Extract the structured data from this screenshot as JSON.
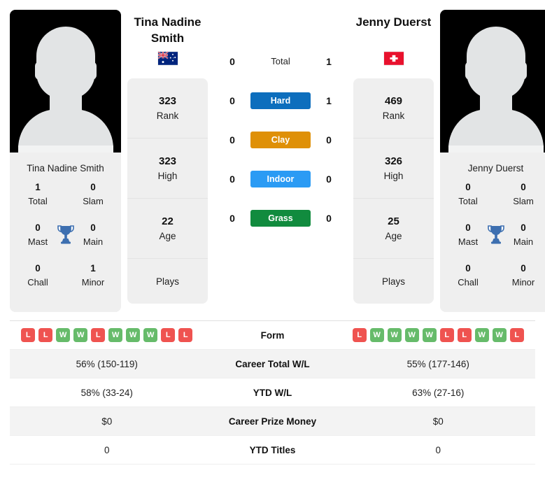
{
  "players": {
    "left": {
      "name": "Tina Nadine Smith",
      "name_line1": "Tina Nadine",
      "name_line2": "Smith",
      "country": "Australia",
      "flag": "au-flag",
      "rank": "323",
      "rank_label": "Rank",
      "high": "323",
      "high_label": "High",
      "age": "22",
      "age_label": "Age",
      "plays": "Plays",
      "plays_value": "",
      "titles": {
        "total": "1",
        "total_label": "Total",
        "slam": "0",
        "slam_label": "Slam",
        "mast": "0",
        "mast_label": "Mast",
        "main": "0",
        "main_label": "Main",
        "chall": "0",
        "chall_label": "Chall",
        "minor": "1",
        "minor_label": "Minor"
      },
      "form": [
        "L",
        "L",
        "W",
        "W",
        "L",
        "W",
        "W",
        "W",
        "L",
        "L"
      ],
      "career_wl": "56% (150-119)",
      "ytd_wl": "58% (33-24)",
      "prize_money": "$0",
      "ytd_titles": "0"
    },
    "right": {
      "name": "Jenny Duerst",
      "name_line1": "Jenny Duerst",
      "name_line2": "",
      "country": "Switzerland",
      "flag": "ch-flag",
      "rank": "469",
      "rank_label": "Rank",
      "high": "326",
      "high_label": "High",
      "age": "25",
      "age_label": "Age",
      "plays": "Plays",
      "plays_value": "",
      "titles": {
        "total": "0",
        "total_label": "Total",
        "slam": "0",
        "slam_label": "Slam",
        "mast": "0",
        "mast_label": "Mast",
        "main": "0",
        "main_label": "Main",
        "chall": "0",
        "chall_label": "Chall",
        "minor": "0",
        "minor_label": "Minor"
      },
      "form": [
        "L",
        "W",
        "W",
        "W",
        "W",
        "L",
        "L",
        "W",
        "W",
        "L"
      ],
      "career_wl": "55% (177-146)",
      "ytd_wl": "63% (27-16)",
      "prize_money": "$0",
      "ytd_titles": "0"
    }
  },
  "head_to_head": {
    "rows": [
      {
        "label": "Total",
        "left": "0",
        "right": "1",
        "pill": false,
        "color": ""
      },
      {
        "label": "Hard",
        "left": "0",
        "right": "1",
        "pill": true,
        "color": "#0d6ebd"
      },
      {
        "label": "Clay",
        "left": "0",
        "right": "0",
        "pill": true,
        "color": "#df9007"
      },
      {
        "label": "Indoor",
        "left": "0",
        "right": "0",
        "pill": true,
        "color": "#2b9bf4"
      },
      {
        "label": "Grass",
        "left": "0",
        "right": "0",
        "pill": true,
        "color": "#118b3e"
      }
    ]
  },
  "stats_table": {
    "rows": [
      {
        "label": "Form",
        "type": "form"
      },
      {
        "label": "Career Total W/L",
        "type": "text",
        "left": "56% (150-119)",
        "right": "55% (177-146)"
      },
      {
        "label": "YTD W/L",
        "type": "text",
        "left": "58% (33-24)",
        "right": "63% (27-16)"
      },
      {
        "label": "Career Prize Money",
        "type": "text",
        "left": "$0",
        "right": "$0"
      },
      {
        "label": "YTD Titles",
        "type": "text",
        "left": "0",
        "right": "0"
      }
    ]
  },
  "colors": {
    "hard": "#0d6ebd",
    "clay": "#df9007",
    "indoor": "#2b9bf4",
    "grass": "#118b3e",
    "win": "#66bb6a",
    "loss": "#ef5350",
    "trophy": "#3d6fb0",
    "card": "#efefef"
  }
}
